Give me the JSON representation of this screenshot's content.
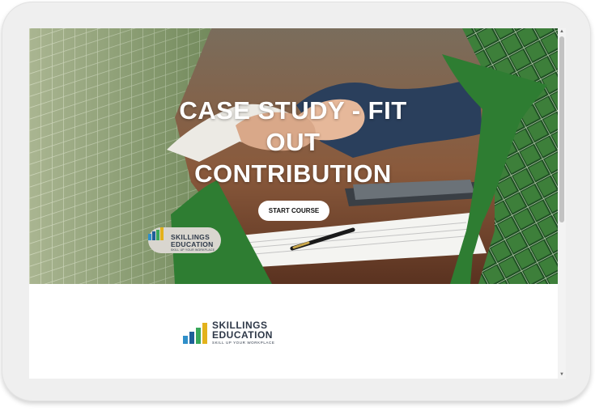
{
  "hero": {
    "title": "CASE STUDY - FIT OUT CONTRIBUTION",
    "start_button_label": "START COURSE"
  },
  "badge": {
    "brand_line1": "SKILLINGS",
    "brand_line2": "EDUCATION",
    "tagline": "SKILL UP YOUR WORKPLACE"
  },
  "footer_logo": {
    "brand_line1": "SKILLINGS",
    "brand_line2": "EDUCATION",
    "tagline": "SKILL UP YOUR WORKPLACE"
  },
  "scrollbar": {
    "up_arrow": "▲",
    "down_arrow": "▼"
  },
  "colors": {
    "accent_green": "#2e7d32",
    "brand_text": "#2e3848",
    "logo_bars": [
      "#2f8fc9",
      "#1f5f99",
      "#39a85a",
      "#e3b21b"
    ]
  }
}
